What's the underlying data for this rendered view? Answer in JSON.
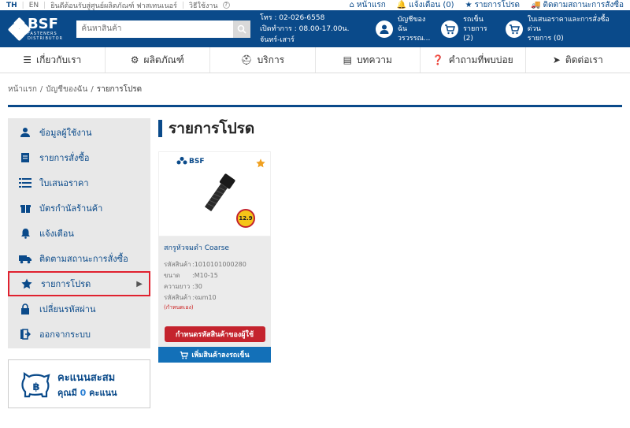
{
  "topbar": {
    "lang_th": "TH",
    "lang_en": "EN",
    "welcome": "ยินดีต้อนรับสู่ศูนย์ผลิตภัณฑ์ ฟาสเทนเนอร์",
    "howto": "วิธีใช้งาน",
    "home": "หน้าแรก",
    "notify": "แจ้งเตือน (0)",
    "favorites": "รายการโปรด",
    "track": "ติดตามสถานะการสั่งซื้อ"
  },
  "header": {
    "logo": "BSF",
    "logo_sub": "FASTENERS DISTRIBUTOR",
    "search_placeholder": "ค้นหาสินค้า",
    "phone": "โทร : 02-026-6558",
    "hours": "เปิดทำการ : 08.00-17.00น. จันทร์-เสาร์",
    "account_title": "บัญชีของฉัน",
    "account_user": "วรวรรณ...",
    "cart_title": "รถเข็น",
    "cart_count": "รายการ (2)",
    "quote_title": "ใบเสนอราคาและการสั่งซื้อด่วน",
    "quote_count": "รายการ (0)"
  },
  "nav": [
    "เกี่ยวกับเรา",
    "ผลิตภัณฑ์",
    "บริการ",
    "บทความ",
    "คำถามที่พบบ่อย",
    "ติดต่อเรา"
  ],
  "breadcrumb": [
    "หน้าแรก",
    "บัญชีของฉัน",
    "รายการโปรด"
  ],
  "sidebar": {
    "items": [
      {
        "label": "ข้อมูลผู้ใช้งาน",
        "icon": "user-icon"
      },
      {
        "label": "รายการสั่งซื้อ",
        "icon": "document-icon"
      },
      {
        "label": "ใบเสนอราคา",
        "icon": "list-icon"
      },
      {
        "label": "บัตรกำนัลร้านค้า",
        "icon": "gift-icon"
      },
      {
        "label": "แจ้งเตือน",
        "icon": "bell-icon"
      },
      {
        "label": "ติดตามสถานะการสั่งซื้อ",
        "icon": "truck-icon"
      },
      {
        "label": "รายการโปรด",
        "icon": "star-icon"
      },
      {
        "label": "เปลี่ยนรหัสผ่าน",
        "icon": "lock-icon"
      },
      {
        "label": "ออกจากระบบ",
        "icon": "logout-icon"
      }
    ],
    "points_title": "คะแนนสะสม",
    "points_prefix": "คุณมี",
    "points_value": "0",
    "points_suffix": "คะแนน"
  },
  "main": {
    "title": "รายการโปรด",
    "product": {
      "badge": "12.9",
      "name": "สกรูหัวจมดำ Coarse",
      "specs": [
        {
          "k": "รหัสสินค้า",
          "v": ":1010101000280"
        },
        {
          "k": "ขนาด",
          "v": ":M10-15"
        },
        {
          "k": "ความยาว",
          "v": ":30"
        },
        {
          "k": "รหัสสินค้า",
          "v": ":จมm10"
        }
      ],
      "note": "(กำหนดเอง)",
      "btn_code": "กำหนดรหัสสินค้าของผู้ใช้",
      "btn_cart": "เพิ่มสินค้าลงรถเข็น"
    }
  },
  "colors": {
    "brand": "#0a4a8a",
    "highlight": "#e0212f",
    "cart_btn": "#1370b8",
    "code_btn": "#c4232d"
  }
}
